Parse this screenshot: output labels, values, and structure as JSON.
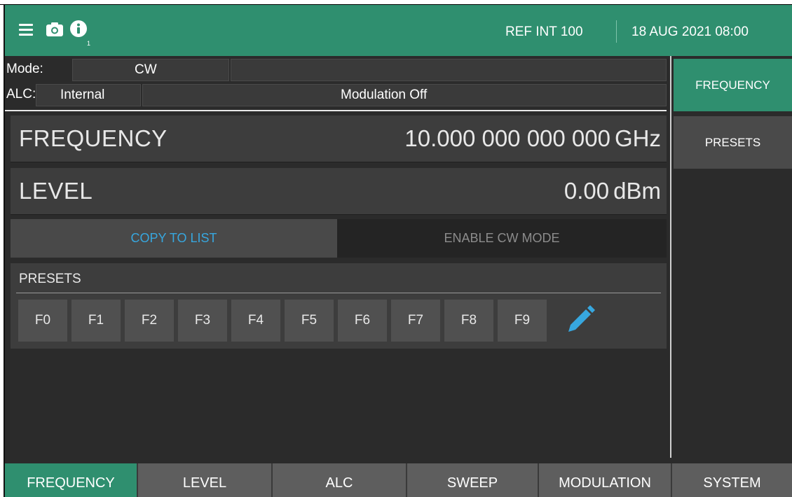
{
  "topbar": {
    "ref_text": "REF INT 100",
    "datetime": "18 AUG 2021 08:00",
    "info_subscript": "1",
    "icons": [
      "menu-icon",
      "camera-icon",
      "info-icon"
    ]
  },
  "status": {
    "mode_label": "Mode:",
    "mode_value": "CW",
    "alc_label": "ALC:",
    "alc_value": "Internal",
    "modulation": "Modulation Off"
  },
  "frequency": {
    "label": "FREQUENCY",
    "value": "10.000 000 000 000",
    "unit": "GHz"
  },
  "level": {
    "label": "LEVEL",
    "value": "0.00",
    "unit": "dBm"
  },
  "actions": {
    "copy_to_list": "COPY TO LIST",
    "enable_cw_mode": "ENABLE CW MODE"
  },
  "presets": {
    "title": "PRESETS",
    "buttons": [
      "F0",
      "F1",
      "F2",
      "F3",
      "F4",
      "F5",
      "F6",
      "F7",
      "F8",
      "F9"
    ]
  },
  "side_menu": {
    "frequency": "FREQUENCY",
    "presets": "PRESETS"
  },
  "tabs": [
    "FREQUENCY",
    "LEVEL",
    "ALC",
    "SWEEP",
    "MODULATION",
    "SYSTEM"
  ],
  "colors": {
    "accent": "#2f8f6f",
    "link": "#37a7df",
    "background": "#2b2b2b"
  }
}
